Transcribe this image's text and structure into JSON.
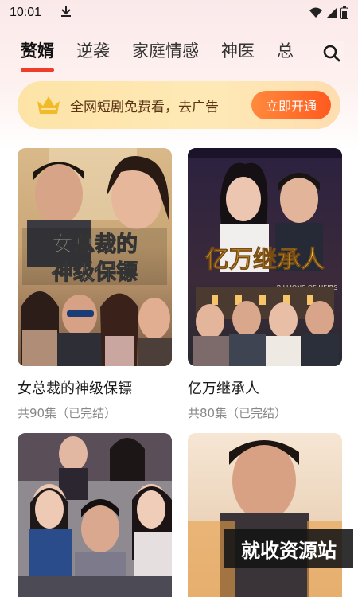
{
  "status_bar": {
    "time": "10:01",
    "download_icon": "download-arrow-icon"
  },
  "tabs": [
    {
      "label": "赘婿",
      "active": true
    },
    {
      "label": "逆袭",
      "active": false
    },
    {
      "label": "家庭情感",
      "active": false
    },
    {
      "label": "神医",
      "active": false
    },
    {
      "label": "总",
      "active": false
    }
  ],
  "search": {
    "icon": "search-icon"
  },
  "vip_banner": {
    "text": "全网短剧免费看，去广告",
    "cta_label": "立即开通",
    "colors": {
      "background": "#fde3a6",
      "cta": "#ff5a1f"
    }
  },
  "dramas": [
    {
      "title": "女总裁的神级保镖",
      "episodes": "共90集（已完结）",
      "poster_title_line1": "女总裁的",
      "poster_title_line2": "神级保镖"
    },
    {
      "title": "亿万继承人",
      "episodes": "共80集（已完结）",
      "poster_title": "亿万继承人",
      "poster_subtitle": "BILLIONS OF HEIRS"
    },
    {
      "title": "",
      "episodes": ""
    },
    {
      "title": "",
      "episodes": ""
    }
  ],
  "watermark": {
    "text": "就收资源站"
  },
  "colors": {
    "accent": "#ee3d2a",
    "tab_text": "#333333",
    "sub_text": "#888888"
  }
}
